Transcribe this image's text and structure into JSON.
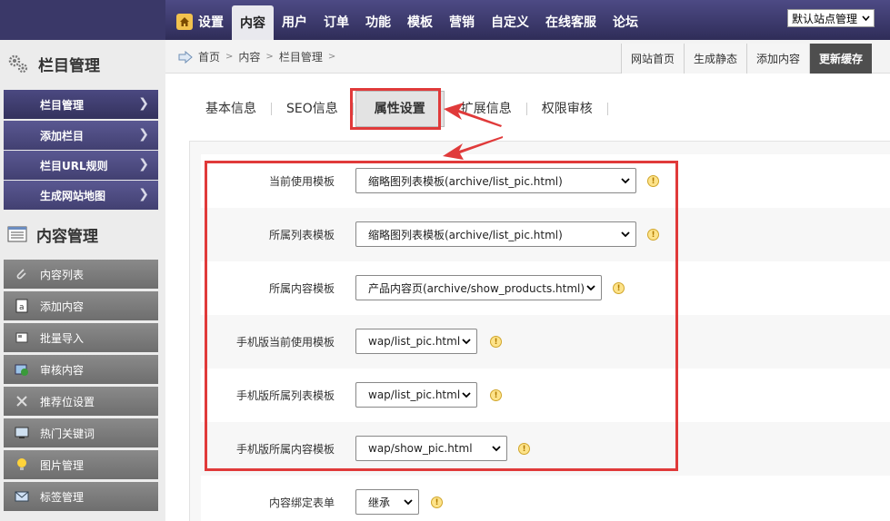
{
  "topnav": {
    "items": [
      "设置",
      "内容",
      "用户",
      "订单",
      "功能",
      "模板",
      "营销",
      "自定义",
      "在线客服",
      "论坛"
    ],
    "active_index": 1,
    "site_select": "默认站点管理"
  },
  "breadcrumb": [
    "首页",
    "内容",
    "栏目管理"
  ],
  "quick_links": [
    "网站首页",
    "生成静态",
    "添加内容",
    "更新缓存"
  ],
  "sidebar": {
    "section1_title": "栏目管理",
    "section1_items": [
      "栏目管理",
      "添加栏目",
      "栏目URL规则",
      "生成网站地图"
    ],
    "section2_title": "内容管理",
    "section2_items": [
      "内容列表",
      "添加内容",
      "批量导入",
      "审核内容",
      "推荐位设置",
      "热门关键词",
      "图片管理",
      "标签管理"
    ]
  },
  "tabs": [
    "基本信息",
    "SEO信息",
    "属性设置",
    "扩展信息",
    "权限审核"
  ],
  "active_tab_index": 2,
  "form": {
    "rows": [
      {
        "label": "当前使用模板",
        "value": "缩略图列表模板(archive/list_pic.html)"
      },
      {
        "label": "所属列表模板",
        "value": "缩略图列表模板(archive/list_pic.html)"
      },
      {
        "label": "所属内容模板",
        "value": "产品内容页(archive/show_products.html)"
      },
      {
        "label": "手机版当前使用模板",
        "value": "wap/list_pic.html"
      },
      {
        "label": "手机版所属列表模板",
        "value": "wap/list_pic.html"
      },
      {
        "label": "手机版所属内容模板",
        "value": "wap/show_pic.html"
      },
      {
        "label": "内容绑定表单",
        "value": "继承"
      }
    ]
  },
  "colors": {
    "highlight": "#e03a3a",
    "nav_bg": "#3c3a6b"
  }
}
